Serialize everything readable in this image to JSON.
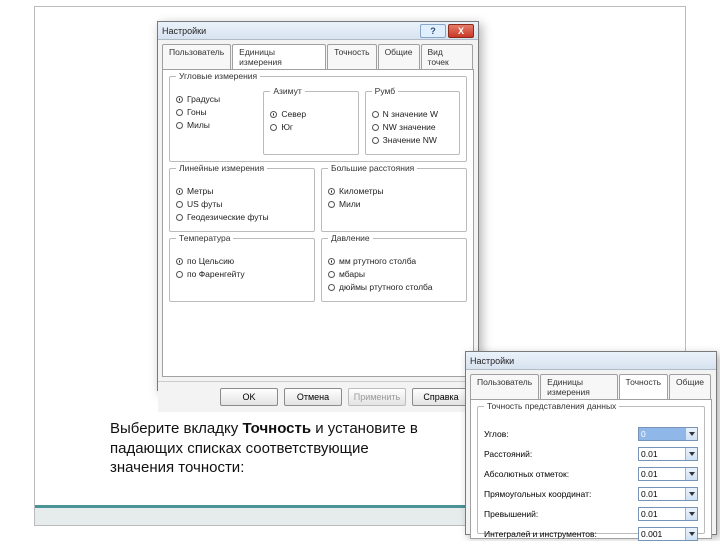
{
  "dialog1": {
    "title": "Настройки",
    "help": "?",
    "close": "X",
    "tabs": [
      "Пользователь",
      "Единицы измерения",
      "Точность",
      "Общие",
      "Вид точек"
    ],
    "activeTab": 1,
    "groups": {
      "angular": {
        "title": "Угловые измерения",
        "opts": [
          "Градусы",
          "Гоны",
          "Милы"
        ],
        "sel": 0
      },
      "azimuth": {
        "title": "Азимут",
        "opts": [
          "Север",
          "Юг"
        ],
        "sel": 0
      },
      "bearing": {
        "title": "Румб",
        "opts": [
          "N значение W",
          "NW значение",
          "Значение NW"
        ],
        "sel": -1
      },
      "linear": {
        "title": "Линейные измерения",
        "opts": [
          "Метры",
          "US футы",
          "Геодезические футы"
        ],
        "sel": 0
      },
      "bigdist": {
        "title": "Большие расстояния",
        "opts": [
          "Километры",
          "Мили"
        ],
        "sel": 0
      },
      "temp": {
        "title": "Температура",
        "opts": [
          "по Цельсию",
          "по Фаренгейту"
        ],
        "sel": 0
      },
      "pressure": {
        "title": "Давление",
        "opts": [
          "мм ртутного столба",
          "мбары",
          "дюймы ртутного столба"
        ],
        "sel": 0
      }
    },
    "buttons": {
      "ok": "OK",
      "cancel": "Отмена",
      "apply": "Применить",
      "help": "Справка"
    }
  },
  "dialog2": {
    "title": "Настройки",
    "tabs": [
      "Пользователь",
      "Единицы измерения",
      "Точность",
      "Общие"
    ],
    "activeTab": 2,
    "group_title": "Точность представления данных",
    "rows": [
      {
        "label": "Углов:",
        "value": "0",
        "hl": true
      },
      {
        "label": "Расстояний:",
        "value": "0.01"
      },
      {
        "label": "Абсолютных отметок:",
        "value": "0.01"
      },
      {
        "label": "Прямоугольных координат:",
        "value": "0.01"
      },
      {
        "label": "Превышений:",
        "value": "0.01"
      },
      {
        "label": "Интегралей и инструментов:",
        "value": "0.001"
      }
    ]
  },
  "caption": {
    "pre": "Выберите вкладку ",
    "bold": "Точность",
    "post": " и установите в падающих списках соответствующие значения точности:"
  }
}
